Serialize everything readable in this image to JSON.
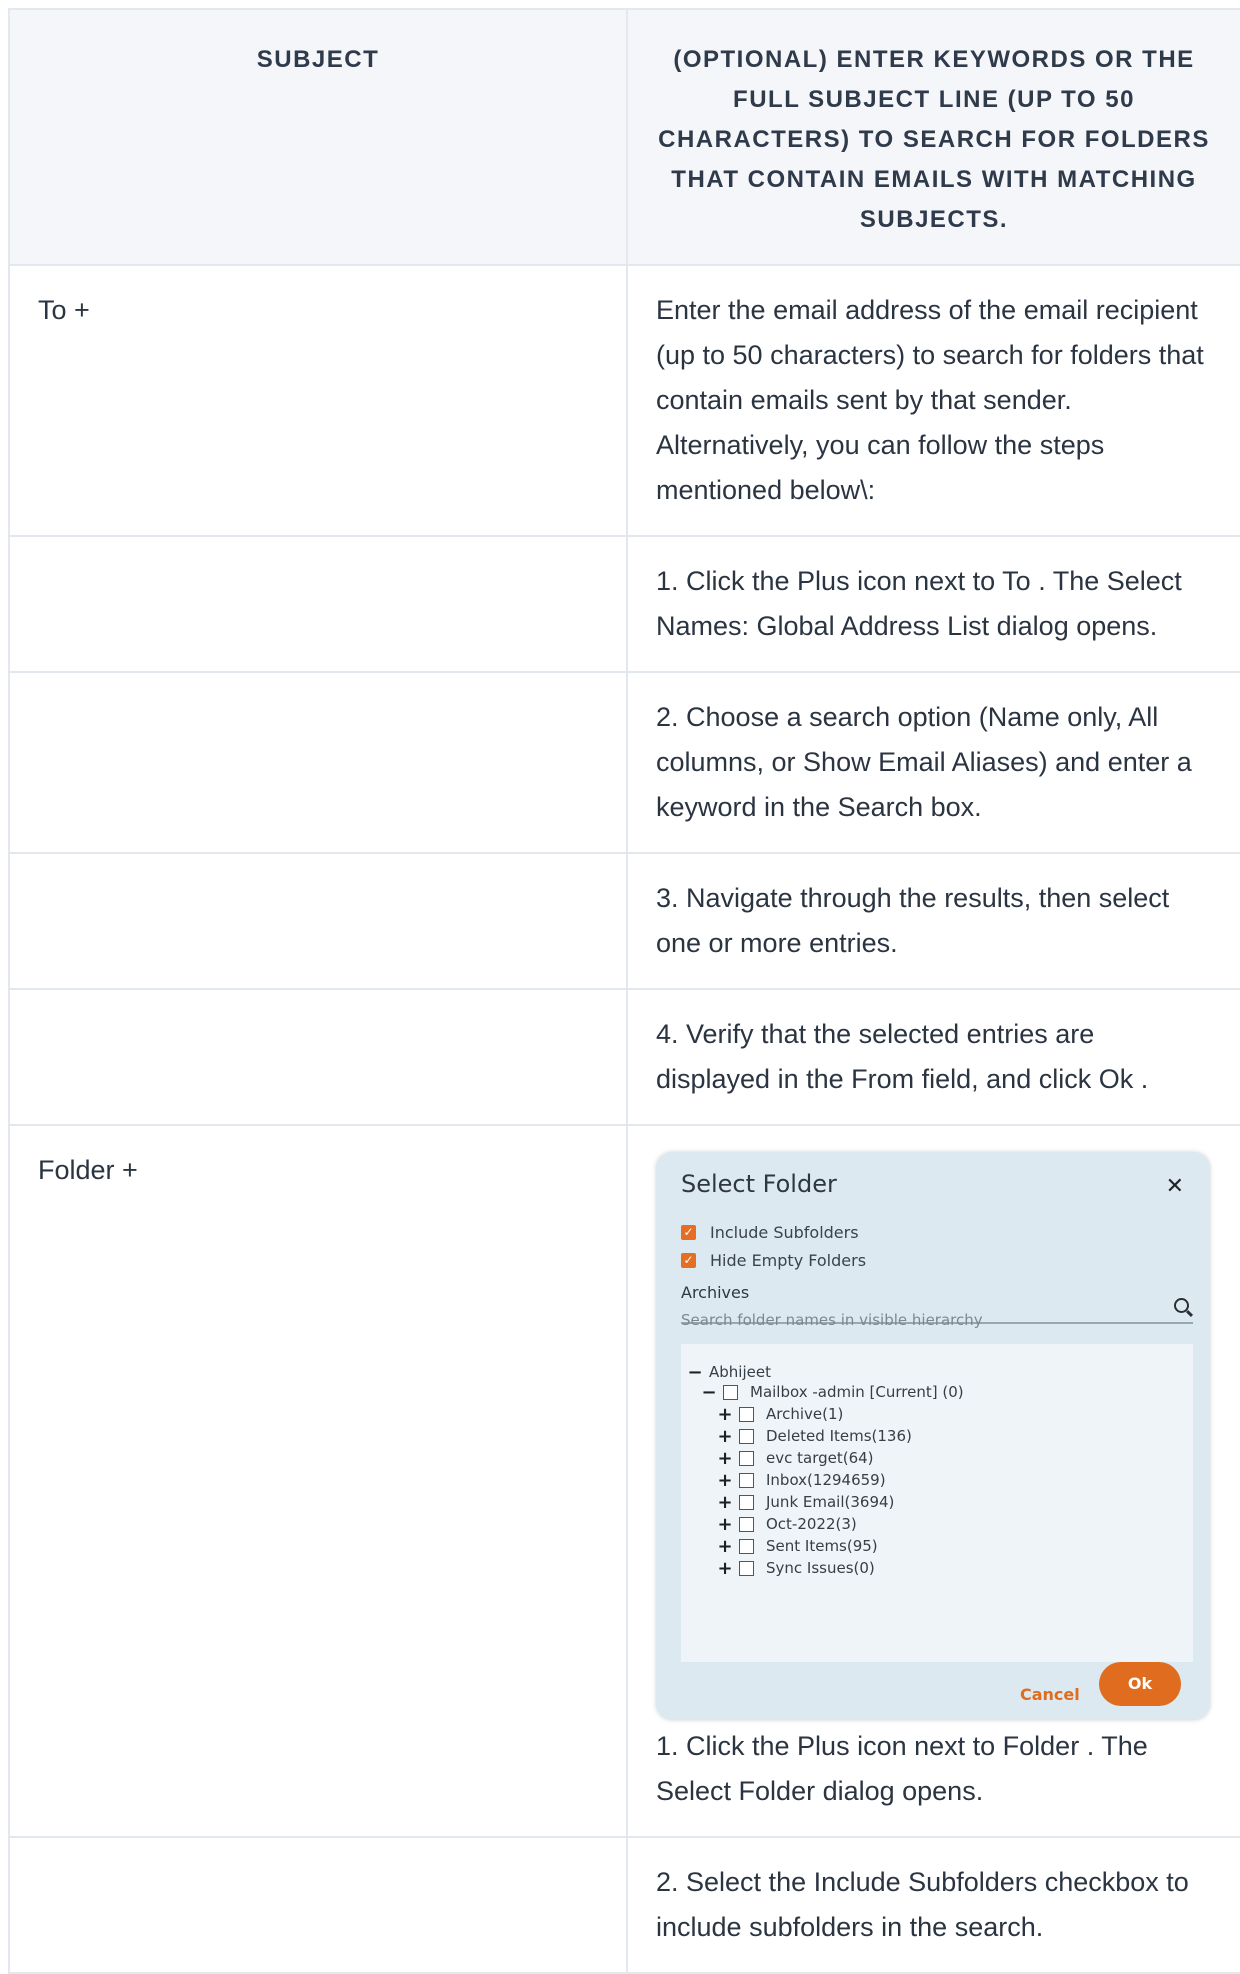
{
  "table": {
    "header": {
      "col1": "SUBJECT",
      "col2": "(OPTIONAL) ENTER KEYWORDS OR THE FULL SUBJECT LINE (UP TO 50 CHARACTERS) TO SEARCH FOR FOLDERS THAT CONTAIN EMAILS WITH MATCHING SUBJECTS."
    },
    "rows": [
      {
        "label": "To +",
        "text": "Enter the email address of the email recipient (up to 50 characters) to search for folders that contain emails sent by that sender. Alternatively, you can follow the steps mentioned below\\:"
      },
      {
        "label": "",
        "text": "1. Click the Plus icon next to To . The Select Names: Global Address List dialog opens."
      },
      {
        "label": "",
        "text": "2. Choose a search option (Name only, All columns, or Show Email Aliases) and enter a keyword in the Search box."
      },
      {
        "label": "",
        "text": "3. Navigate through the results, then select one or more entries."
      },
      {
        "label": "",
        "text": "4. Verify that the selected entries are displayed in the From field, and click Ok ."
      },
      {
        "label": "Folder +",
        "text": "1. Click the Plus icon next to Folder . The Select Folder dialog opens."
      },
      {
        "label": "",
        "text": "2. Select the Include Subfolders checkbox to include subfolders in the search."
      }
    ]
  },
  "dialog": {
    "title": "Select Folder",
    "include_subfolders": "Include Subfolders",
    "hide_empty_folders": "Hide Empty Folders",
    "section_label": "Archives",
    "search_placeholder": "Search folder names in visible hierarchy",
    "tree": {
      "root": "Abhijeet",
      "mailbox": "Mailbox -admin [Current] (0)",
      "folders": [
        "Archive(1)",
        "Deleted Items(136)",
        "evc target(64)",
        "Inbox(1294659)",
        "Junk Email(3694)",
        "Oct-2022(3)",
        "Sent Items(95)",
        "Sync Issues(0)"
      ]
    },
    "cancel_label": "Cancel",
    "ok_label": "Ok"
  },
  "colors": {
    "accent": "#e06c1f",
    "dialog_bg": "#dde9f0",
    "border": "#e3e7ee"
  }
}
